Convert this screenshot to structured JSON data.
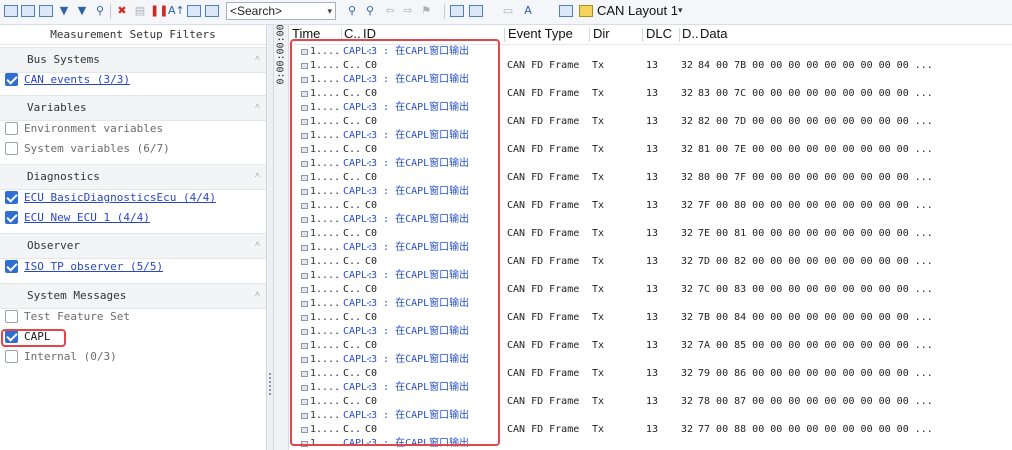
{
  "toolbar": {
    "search_placeholder": "<Search>",
    "layout_name": "CAN Layout 1"
  },
  "filters": {
    "title": "Measurement Setup Filters",
    "groups": [
      {
        "name": "Bus Systems",
        "items": [
          {
            "label": "CAN events (3/3)",
            "checked": true
          }
        ]
      },
      {
        "name": "Variables",
        "items": [
          {
            "label": "Environment variables",
            "checked": false
          },
          {
            "label": "System variables (6/7)",
            "checked": false
          }
        ]
      },
      {
        "name": "Diagnostics",
        "items": [
          {
            "label": "ECU BasicDiagnosticsEcu (4/4)",
            "checked": true
          },
          {
            "label": "ECU New ECU 1 (4/4)",
            "checked": true
          }
        ]
      },
      {
        "name": "Observer",
        "items": [
          {
            "label": "ISO TP observer (5/5)",
            "checked": true
          }
        ]
      },
      {
        "name": "System Messages",
        "items": [
          {
            "label": "Test Feature Set",
            "checked": false
          },
          {
            "label": "CAPL",
            "checked": true
          },
          {
            "label": "Internal (0/3)",
            "checked": false
          }
        ]
      }
    ]
  },
  "ruler_time": "0:00:00:00",
  "trace": {
    "columns": {
      "time": "Time",
      "chn": "C..",
      "id": "ID",
      "event_type": "Event Type",
      "dir": "Dir",
      "dlc": "DLC",
      "data_len": "D..",
      "data": "Data"
    },
    "capl_row": {
      "time": "1....",
      "chn": "CAPL:",
      "message": "-3 : 在CAPL窗口输出"
    },
    "frame_rows": [
      {
        "time": "1....",
        "chn": "C..",
        "id": "C0",
        "event_type": "CAN FD Frame",
        "dir": "Tx",
        "dlc": "13",
        "data_len": "32",
        "data": "84 00 7B 00 00 00 00 00 00 00 00 00  ..."
      },
      {
        "time": "1....",
        "chn": "C..",
        "id": "C0",
        "event_type": "CAN FD Frame",
        "dir": "Tx",
        "dlc": "13",
        "data_len": "32",
        "data": "83 00 7C 00 00 00 00 00 00 00 00 00  ..."
      },
      {
        "time": "1....",
        "chn": "C..",
        "id": "C0",
        "event_type": "CAN FD Frame",
        "dir": "Tx",
        "dlc": "13",
        "data_len": "32",
        "data": "82 00 7D 00 00 00 00 00 00 00 00 00  ..."
      },
      {
        "time": "1....",
        "chn": "C..",
        "id": "C0",
        "event_type": "CAN FD Frame",
        "dir": "Tx",
        "dlc": "13",
        "data_len": "32",
        "data": "81 00 7E 00 00 00 00 00 00 00 00 00  ..."
      },
      {
        "time": "1....",
        "chn": "C..",
        "id": "C0",
        "event_type": "CAN FD Frame",
        "dir": "Tx",
        "dlc": "13",
        "data_len": "32",
        "data": "80 00 7F 00 00 00 00 00 00 00 00 00  ..."
      },
      {
        "time": "1....",
        "chn": "C..",
        "id": "C0",
        "event_type": "CAN FD Frame",
        "dir": "Tx",
        "dlc": "13",
        "data_len": "32",
        "data": "7F 00 80 00 00 00 00 00 00 00 00 00  ..."
      },
      {
        "time": "1....",
        "chn": "C..",
        "id": "C0",
        "event_type": "CAN FD Frame",
        "dir": "Tx",
        "dlc": "13",
        "data_len": "32",
        "data": "7E 00 81 00 00 00 00 00 00 00 00 00  ..."
      },
      {
        "time": "1....",
        "chn": "C..",
        "id": "C0",
        "event_type": "CAN FD Frame",
        "dir": "Tx",
        "dlc": "13",
        "data_len": "32",
        "data": "7D 00 82 00 00 00 00 00 00 00 00 00  ..."
      },
      {
        "time": "1....",
        "chn": "C..",
        "id": "C0",
        "event_type": "CAN FD Frame",
        "dir": "Tx",
        "dlc": "13",
        "data_len": "32",
        "data": "7C 00 83 00 00 00 00 00 00 00 00 00  ..."
      },
      {
        "time": "1....",
        "chn": "C..",
        "id": "C0",
        "event_type": "CAN FD Frame",
        "dir": "Tx",
        "dlc": "13",
        "data_len": "32",
        "data": "7B 00 84 00 00 00 00 00 00 00 00 00  ..."
      },
      {
        "time": "1....",
        "chn": "C..",
        "id": "C0",
        "event_type": "CAN FD Frame",
        "dir": "Tx",
        "dlc": "13",
        "data_len": "32",
        "data": "7A 00 85 00 00 00 00 00 00 00 00 00  ..."
      },
      {
        "time": "1....",
        "chn": "C..",
        "id": "C0",
        "event_type": "CAN FD Frame",
        "dir": "Tx",
        "dlc": "13",
        "data_len": "32",
        "data": "79 00 86 00 00 00 00 00 00 00 00 00  ..."
      },
      {
        "time": "1....",
        "chn": "C..",
        "id": "C0",
        "event_type": "CAN FD Frame",
        "dir": "Tx",
        "dlc": "13",
        "data_len": "32",
        "data": "78 00 87 00 00 00 00 00 00 00 00 00  ..."
      },
      {
        "time": "1....",
        "chn": "C..",
        "id": "C0",
        "event_type": "CAN FD Frame",
        "dir": "Tx",
        "dlc": "13",
        "data_len": "32",
        "data": "77 00 88 00 00 00 00 00 00 00 00 00  ..."
      }
    ]
  }
}
